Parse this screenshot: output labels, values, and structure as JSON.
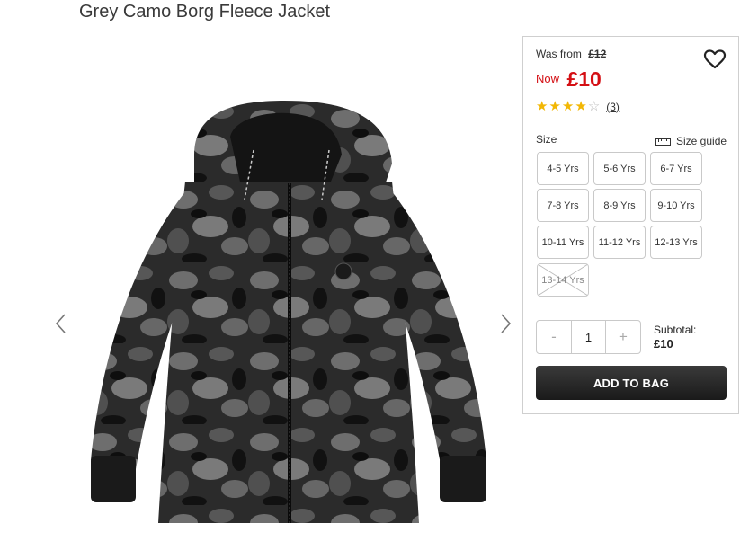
{
  "product": {
    "title": "Grey Camo Borg Fleece Jacket",
    "was_label": "Was from",
    "was_price": "£12",
    "now_label": "Now",
    "now_price": "£10",
    "rating": 4,
    "rating_max": 5,
    "review_count": "(3)"
  },
  "size_section": {
    "label": "Size",
    "guide_label": "Size guide",
    "sizes": [
      {
        "label": "4-5 Yrs",
        "available": true
      },
      {
        "label": "5-6 Yrs",
        "available": true
      },
      {
        "label": "6-7 Yrs",
        "available": true
      },
      {
        "label": "7-8 Yrs",
        "available": true
      },
      {
        "label": "8-9 Yrs",
        "available": true
      },
      {
        "label": "9-10 Yrs",
        "available": true
      },
      {
        "label": "10-11 Yrs",
        "available": true
      },
      {
        "label": "11-12 Yrs",
        "available": true
      },
      {
        "label": "12-13 Yrs",
        "available": true
      },
      {
        "label": "13-14 Yrs",
        "available": false
      }
    ]
  },
  "quantity": {
    "minus": "-",
    "value": "1",
    "plus": "+"
  },
  "subtotal": {
    "label": "Subtotal:",
    "value": "£10"
  },
  "add_to_bag": "ADD TO BAG",
  "icons": {
    "heart": "heart-icon",
    "prev": "chevron-left-icon",
    "next": "chevron-right-icon",
    "ruler": "ruler-icon"
  },
  "colors": {
    "price_red": "#d40f14",
    "star_gold": "#f2b705",
    "button_dark": "#2a2a2a"
  }
}
